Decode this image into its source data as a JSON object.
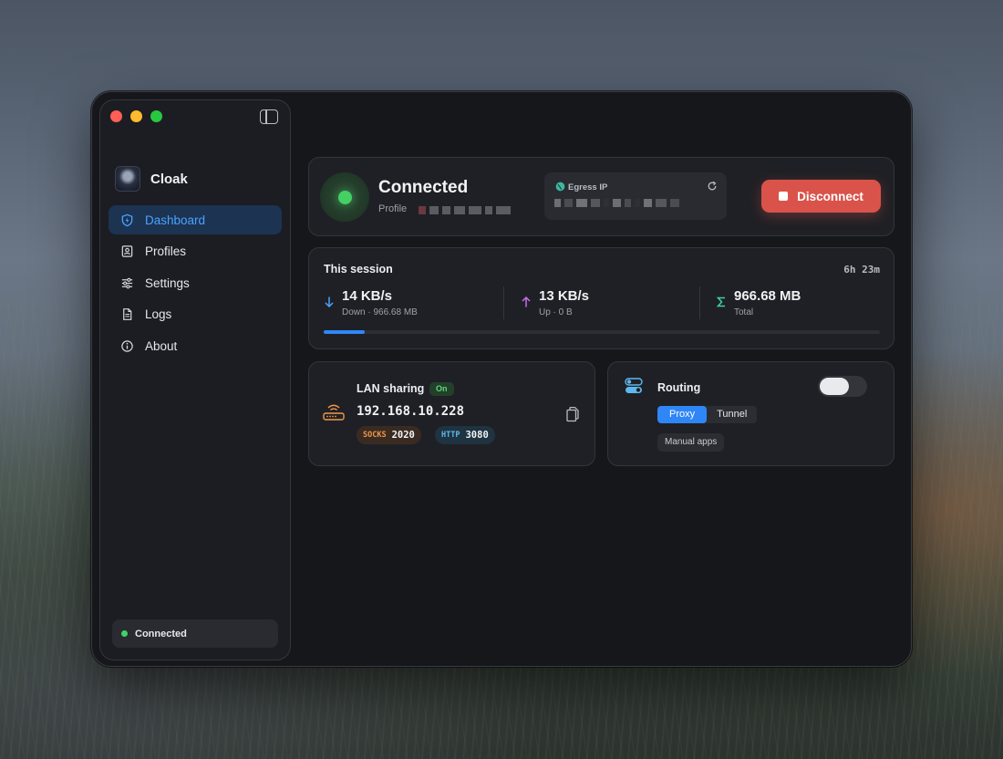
{
  "app": {
    "name": "Cloak"
  },
  "sidebar": {
    "items": [
      {
        "label": "Dashboard",
        "icon": "shield-bolt-icon",
        "active": true
      },
      {
        "label": "Profiles",
        "icon": "profile-card-icon",
        "active": false
      },
      {
        "label": "Settings",
        "icon": "sliders-icon",
        "active": false
      },
      {
        "label": "Logs",
        "icon": "document-icon",
        "active": false
      },
      {
        "label": "About",
        "icon": "info-icon",
        "active": false
      }
    ],
    "status": "Connected"
  },
  "connection": {
    "status": "Connected",
    "profile_label": "Profile",
    "egress_label": "Egress IP",
    "disconnect_label": "Disconnect"
  },
  "session": {
    "title": "This session",
    "duration": "6h 23m",
    "down": {
      "value": "14 KB/s",
      "sub": "Down · 966.68 MB"
    },
    "up": {
      "value": "13 KB/s",
      "sub": "Up · 0 B"
    },
    "total": {
      "value": "966.68 MB",
      "sub": "Total"
    },
    "progress": 0.074
  },
  "lan": {
    "title": "LAN sharing",
    "badge": "On",
    "ip": "192.168.10.228",
    "socks_key": "SOCKS",
    "socks_port": "2020",
    "http_key": "HTTP",
    "http_port": "3080"
  },
  "routing": {
    "title": "Routing",
    "enabled": false,
    "modes": [
      "Proxy",
      "Tunnel"
    ],
    "selected_mode": "Proxy",
    "manual_apps": "Manual apps"
  },
  "colors": {
    "accent": "#2f86f6",
    "danger": "#d9534a",
    "success": "#45d064"
  }
}
